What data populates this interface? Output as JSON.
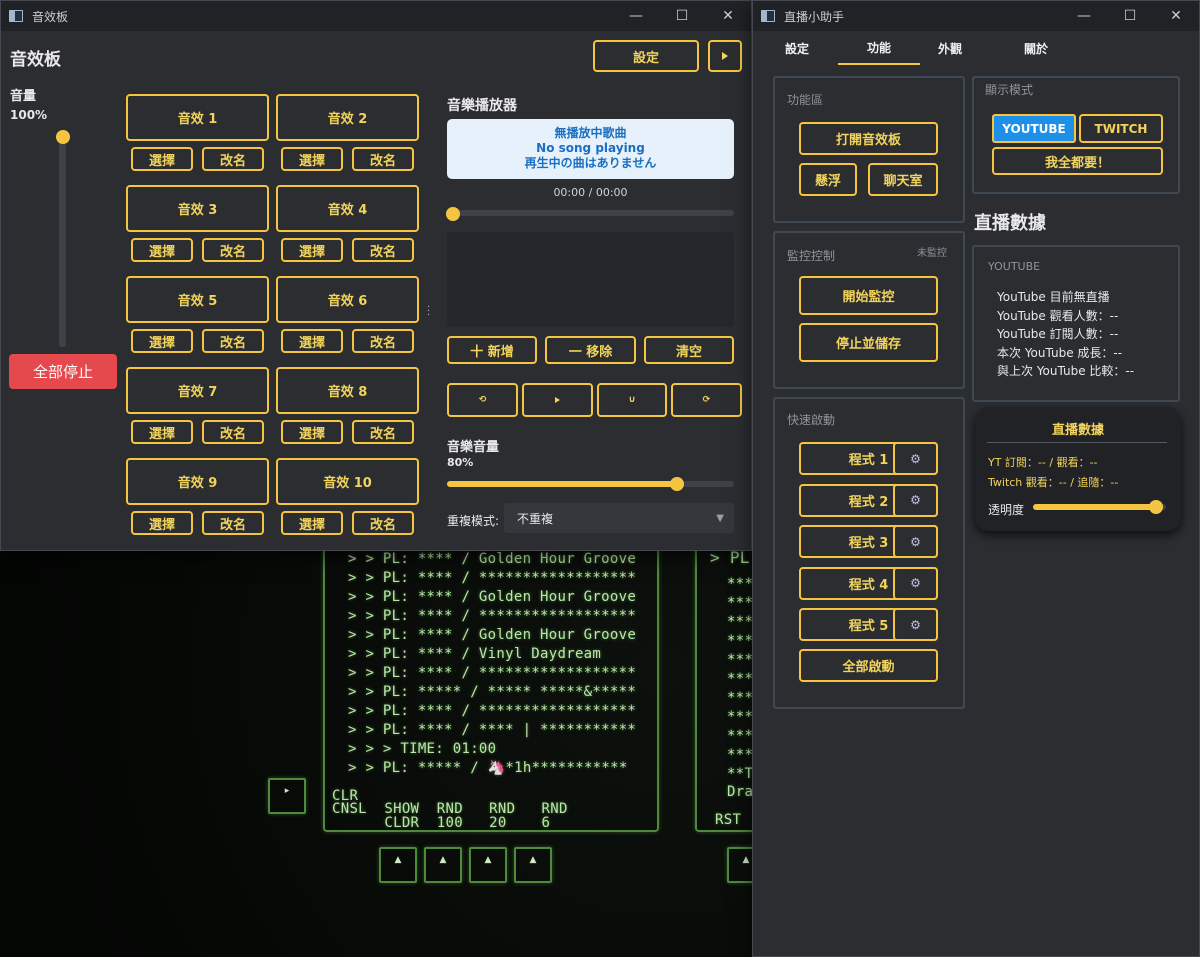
{
  "soundboard": {
    "window_title": "音效板",
    "heading": "音效板",
    "settings_label": "設定",
    "volume_label": "音量",
    "volume_value": "100%",
    "volume_level": 1.0,
    "stop_all_label": "全部停止",
    "sounds": [
      {
        "label": "音效 1",
        "select": "選擇",
        "rename": "改名"
      },
      {
        "label": "音效 2",
        "select": "選擇",
        "rename": "改名"
      },
      {
        "label": "音效 3",
        "select": "選擇",
        "rename": "改名"
      },
      {
        "label": "音效 4",
        "select": "選擇",
        "rename": "改名"
      },
      {
        "label": "音效 5",
        "select": "選擇",
        "rename": "改名"
      },
      {
        "label": "音效 6",
        "select": "選擇",
        "rename": "改名"
      },
      {
        "label": "音效 7",
        "select": "選擇",
        "rename": "改名"
      },
      {
        "label": "音效 8",
        "select": "選擇",
        "rename": "改名"
      },
      {
        "label": "音效 9",
        "select": "選擇",
        "rename": "改名"
      },
      {
        "label": "音效 10",
        "select": "選擇",
        "rename": "改名"
      }
    ],
    "player": {
      "heading": "音樂播放器",
      "now_playing_zh": "無播放中歌曲",
      "now_playing_en": "No song playing",
      "now_playing_ja": "再生中の曲はありません",
      "time": "00:00 / 00:00",
      "progress": 0.0,
      "add_label": "十 新增",
      "remove_label": "一 移除",
      "clear_label": "清空",
      "controls": [
        "prev-icon",
        "play-icon",
        "pause-icon",
        "next-icon"
      ],
      "music_volume_label": "音樂音量",
      "music_volume_value": "80%",
      "music_volume_level": 0.8,
      "repeat_label": "重複模式:",
      "repeat_value": "不重複"
    }
  },
  "assistant": {
    "window_title": "直播小助手",
    "tabs": [
      "設定",
      "功能",
      "外觀",
      "關於"
    ],
    "active_tab": "功能",
    "functions": {
      "heading": "功能區",
      "open_soundboard": "打開音效板",
      "float": "懸浮",
      "chatroom": "聊天室"
    },
    "monitor": {
      "heading": "監控控制",
      "status": "未監控",
      "start": "開始監控",
      "stop_save": "停止並儲存"
    },
    "quick_launch": {
      "heading": "快速啟動",
      "programs": [
        "程式 1",
        "程式 2",
        "程式 3",
        "程式 4",
        "程式 5"
      ],
      "launch_all": "全部啟動"
    },
    "display_mode": {
      "heading": "顯示模式",
      "youtube": "YOUTUBE",
      "twitch": "TWITCH",
      "all": "我全都要！"
    },
    "stats": {
      "heading": "直播數據",
      "platform": "YOUTUBE",
      "lines": [
        "YouTube 目前無直播",
        "YouTube 觀看人數：--",
        "YouTube 訂閱人數：--",
        "本次 YouTube 成長：--",
        "與上次 YouTube 比較：--"
      ]
    },
    "overlay": {
      "title": "直播數據",
      "yt_line": "YT 訂閱：-- / 觀看：--",
      "twitch_line": "Twitch 觀看：-- / 追隨：--",
      "opacity_label": "透明度",
      "opacity_level": 0.95
    }
  },
  "terminal": {
    "lines": [
      "> > PL: **** / Golden Hour Groove",
      "> > PL: **** / ******************",
      "> > PL: **** / Golden Hour Groove",
      "> > PL: **** / ******************",
      "> > PL: **** / Golden Hour Groove",
      "> > PL: **** / Vinyl Daydream",
      "> > PL: **** / ******************",
      "> > PL: ***** / ***** *****&*****",
      "> > PL: **** / ******************",
      "> > PL: **** / **** | ***********",
      "> > > TIME: 01:00",
      "> > PL: ***** / 🦄*1h***********"
    ],
    "footer_row1": "CLR",
    "footer_row2": "CNSL  SHOW  RND   RND   RND",
    "footer_row3": "      CLDR  100   20    6",
    "right_header": "> PL",
    "right_lines": [
      "***",
      "***",
      "***",
      "***",
      "***",
      "***",
      "***",
      "***",
      "***",
      "***"
    ],
    "right_tail1": "**Ta",
    "right_tail2": "Drag",
    "right_footer": "RST"
  }
}
